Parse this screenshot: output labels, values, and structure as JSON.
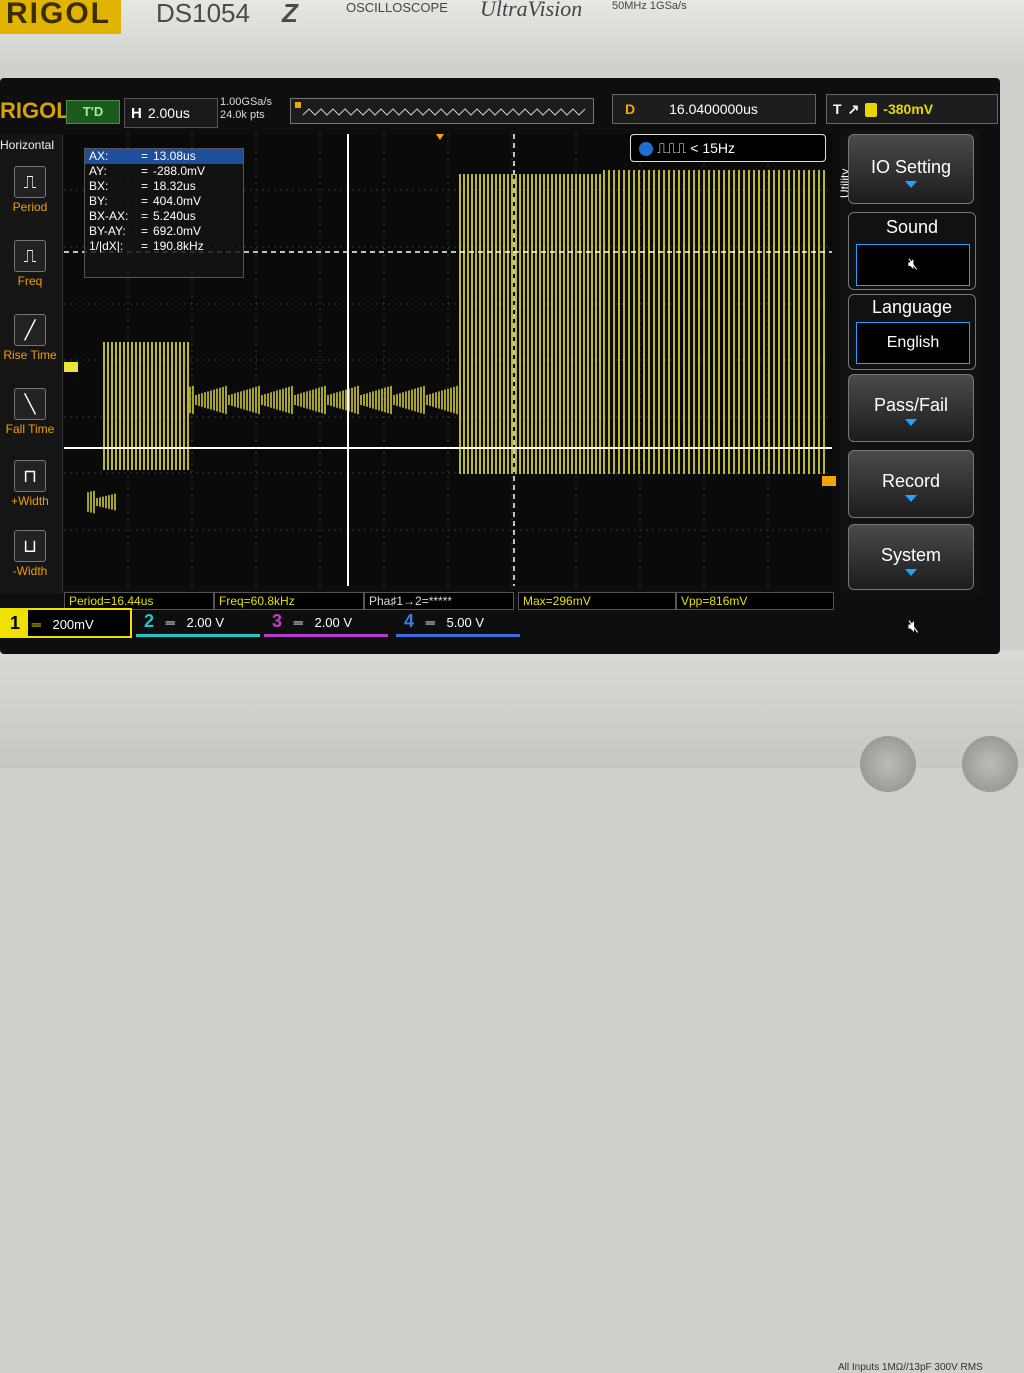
{
  "device": {
    "brand": "RIGOL",
    "model": "DS1054",
    "model_suffix": "Z",
    "type_label": "OSCILLOSCOPE",
    "series": "UltraVision",
    "specs": "50MHz 1GSa/s",
    "input_spec": "All Inputs 1MΩ//13pF 300V RMS"
  },
  "status": {
    "logo": "RIGOL",
    "trigger_state": "T'D",
    "h_label": "H",
    "timebase": "2.00us",
    "sample_rate": "1.00GSa/s",
    "memory_depth": "24.0k pts",
    "delay_label": "D",
    "delay": "16.0400000us",
    "trig_label": "T",
    "trigger_level": "-380mV"
  },
  "left_menu": {
    "title": "Horizontal",
    "items": [
      "Period",
      "Freq",
      "Rise Time",
      "Fall Time",
      "+Width",
      "-Width"
    ]
  },
  "cursor_panel": {
    "rows": [
      {
        "key": "AX:",
        "value": "13.08us"
      },
      {
        "key": "AY:",
        "value": "-288.0mV"
      },
      {
        "key": "BX:",
        "value": "18.32us"
      },
      {
        "key": "BY:",
        "value": "404.0mV"
      },
      {
        "key": "BX-AX:",
        "value": "5.240us"
      },
      {
        "key": "BY-AY:",
        "value": "692.0mV"
      },
      {
        "key": "1/|dX|:",
        "value": "190.8kHz"
      }
    ]
  },
  "freq_counter": {
    "value": "< 15Hz",
    "channel": "2"
  },
  "right_menu": {
    "title": "Utility",
    "io_setting": "IO Setting",
    "sound": "Sound",
    "language": "Language",
    "language_value": "English",
    "pass_fail": "Pass/Fail",
    "record": "Record",
    "system": "System"
  },
  "measurements": {
    "period": "Period=16.44us",
    "freq": "Freq=60.8kHz",
    "phase": "Pha♯1→2=*****",
    "max": "Max=296mV",
    "vpp": "Vpp=816mV"
  },
  "channels": [
    {
      "num": "1",
      "scale": "200mV",
      "color": "#f0e000"
    },
    {
      "num": "2",
      "scale": "2.00 V",
      "color": "#1ec8c8"
    },
    {
      "num": "3",
      "scale": "2.00 V",
      "color": "#c83cc8"
    },
    {
      "num": "4",
      "scale": "5.00 V",
      "color": "#3c7ee0"
    }
  ],
  "colors": {
    "trace": "#e8e43a",
    "accent": "#1ea3ff",
    "trigger": "#f5a500"
  }
}
